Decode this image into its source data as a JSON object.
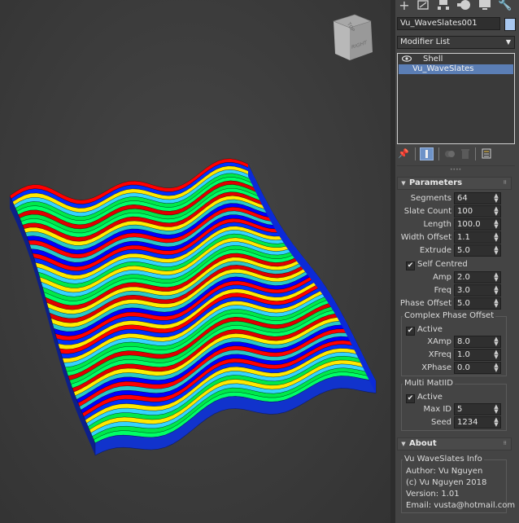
{
  "command_tabs": [
    "create-icon",
    "modify-icon",
    "hierarchy-icon",
    "motion-icon",
    "display-icon",
    "utilities-icon"
  ],
  "object_name": "Vu_WaveSlates001",
  "object_color": "#a9c8f0",
  "modifier_list": {
    "label": "Modifier List"
  },
  "stack": {
    "items": [
      {
        "label": "Shell",
        "selected": false
      },
      {
        "label": "Vu_WaveSlates",
        "selected": true
      }
    ]
  },
  "viewcube": {
    "top": "TOP",
    "right": "RIGHT"
  },
  "parameters": {
    "title": "Parameters",
    "segments": {
      "label": "Segments",
      "value": "64"
    },
    "slate_count": {
      "label": "Slate Count",
      "value": "100"
    },
    "length": {
      "label": "Length",
      "value": "100.0"
    },
    "width_offset": {
      "label": "Width Offset",
      "value": "1.1"
    },
    "extrude": {
      "label": "Extrude",
      "value": "5.0"
    },
    "self_centred": {
      "label": "Self Centred",
      "checked": true
    },
    "amp": {
      "label": "Amp",
      "value": "2.0"
    },
    "freq": {
      "label": "Freq",
      "value": "3.0"
    },
    "phase_offset": {
      "label": "Phase Offset",
      "value": "5.0"
    }
  },
  "complex_phase": {
    "title": "Complex Phase Offset",
    "active": {
      "label": "Active",
      "checked": true
    },
    "xamp": {
      "label": "XAmp",
      "value": "8.0"
    },
    "xfreq": {
      "label": "XFreq",
      "value": "1.0"
    },
    "xphase": {
      "label": "XPhase",
      "value": "0.0"
    }
  },
  "multi_matid": {
    "title": "Multi MatIID",
    "active": {
      "label": "Active",
      "checked": true
    },
    "max_id": {
      "label": "Max ID",
      "value": "5"
    },
    "seed": {
      "label": "Seed",
      "value": "1234"
    }
  },
  "about": {
    "title": "About",
    "group_title": "Vu WaveSlates Info",
    "author": "Author: Vu Nguyen",
    "copyright": "(c) Vu Nguyen 2018",
    "version": "Version: 1.01",
    "email": "Email: vusta@hotmail.com"
  },
  "slate_colors": [
    "#ff0000",
    "#ffee00",
    "#00e84a",
    "#0030ff",
    "#28c8c8",
    "#00ff66",
    "#ffe800",
    "#0000ff",
    "#e00000",
    "#34d4ff"
  ],
  "side_color": "#0d1f8a",
  "bottom_color": "#1133cc"
}
